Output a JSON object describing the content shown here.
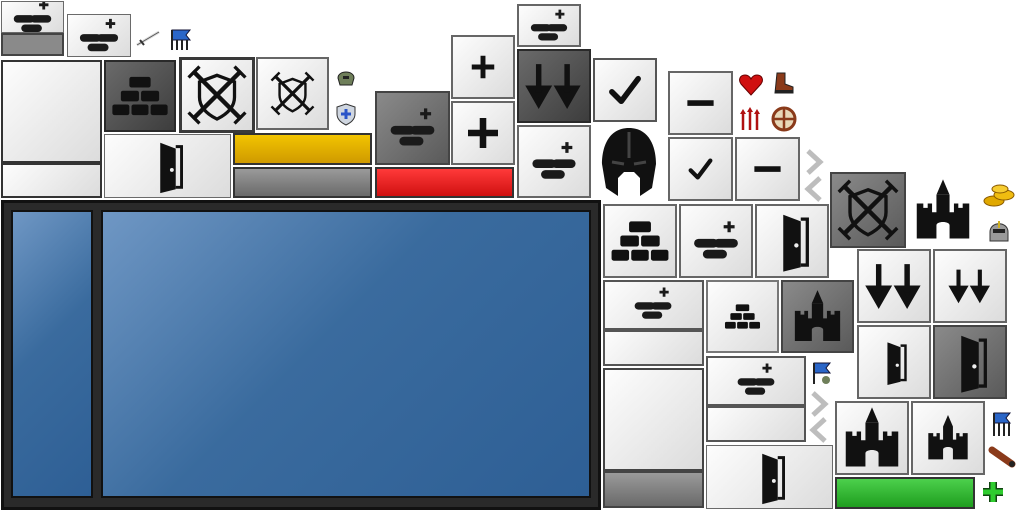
{
  "sheet": {
    "type": "ui-sprite-atlas",
    "colors": {
      "panel_light": "#e6e6e6",
      "panel_dark": "#4a4a4a",
      "window_blue": "#3a6b9e",
      "bar_yellow": "#e8b400",
      "bar_red": "#e02020",
      "bar_green": "#2fb52f",
      "bar_gray": "#8a8a8a"
    },
    "icons": [
      "bricks-icon",
      "wall-icon",
      "crossed-swords-shield-icon",
      "door-icon",
      "plus-icon",
      "minus-icon",
      "checkmark-icon",
      "double-arrow-down-icon",
      "castle-icon",
      "helmet-icon",
      "heart-icon",
      "boot-icon",
      "arrows-icon",
      "target-icon",
      "sword-icon",
      "banner-icon",
      "coins-icon",
      "shield-icon",
      "chevron-right-icon",
      "chevron-left-icon",
      "cannon-icon",
      "green-plus-icon"
    ]
  }
}
